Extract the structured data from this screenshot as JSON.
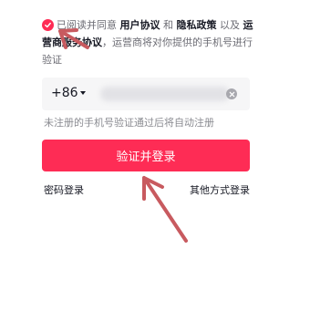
{
  "agreement": {
    "prefix": "已阅读并同意 ",
    "user_agreement": "用户协议",
    "and": " 和 ",
    "privacy_policy": "隐私政策",
    "and2": " 以及 ",
    "operator_agreement": "运营商服务协议",
    "suffix": "，运营商将对你提供的手机号进行验证",
    "checked": true
  },
  "phone": {
    "country_code": "+86",
    "value_redacted": true
  },
  "hint": "未注册的手机号验证通过后将自动注册",
  "submit_label": "验证并登录",
  "links": {
    "password_login": "密码登录",
    "other_methods": "其他方式登录"
  },
  "colors": {
    "accent": "#fe2c55",
    "annotation_arrow": "#c85a5f"
  }
}
